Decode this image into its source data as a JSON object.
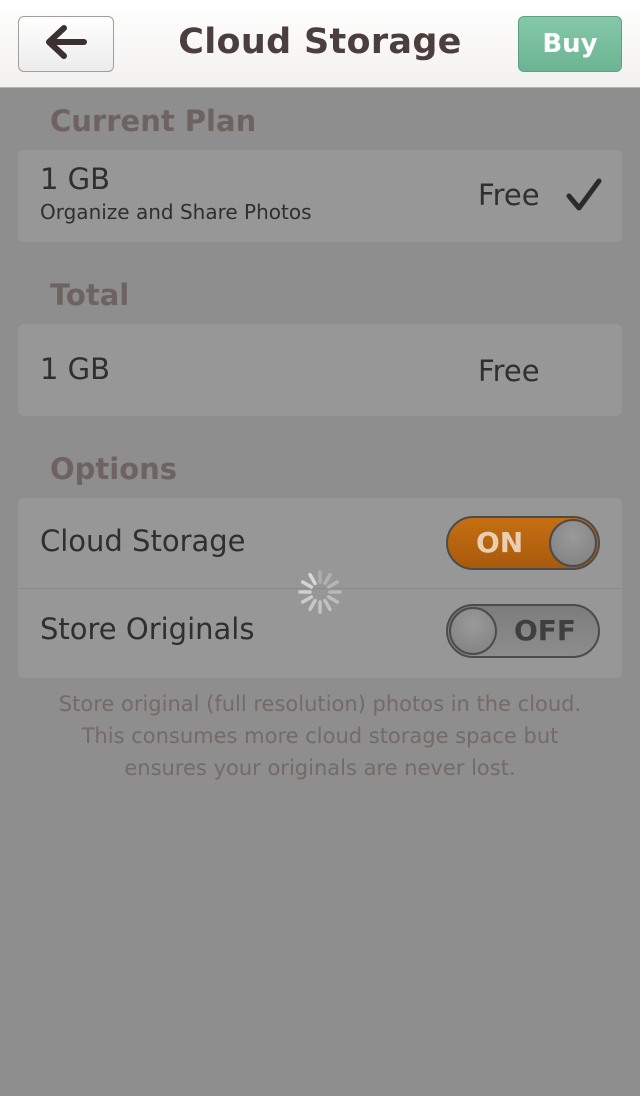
{
  "nav": {
    "title": "Cloud Storage",
    "buy_label": "Buy",
    "back_icon": "arrow-left-icon"
  },
  "current_plan": {
    "heading": "Current Plan",
    "size": "1 GB",
    "description": "Organize and Share Photos",
    "price": "Free",
    "selected_icon": "checkmark-icon"
  },
  "total": {
    "heading": "Total",
    "size": "1 GB",
    "price": "Free"
  },
  "options": {
    "heading": "Options",
    "items": [
      {
        "label": "Cloud Storage",
        "state": "ON",
        "on": true
      },
      {
        "label": "Store Originals",
        "state": "OFF",
        "on": false
      }
    ],
    "footnote": "Store original (full resolution) photos in the cloud. This consumes more cloud storage space but ensures your originals are never lost."
  },
  "colors": {
    "accent_buy": "#6cb493",
    "toggle_on": "#c56f12",
    "overlay": "#8e8e8e"
  }
}
